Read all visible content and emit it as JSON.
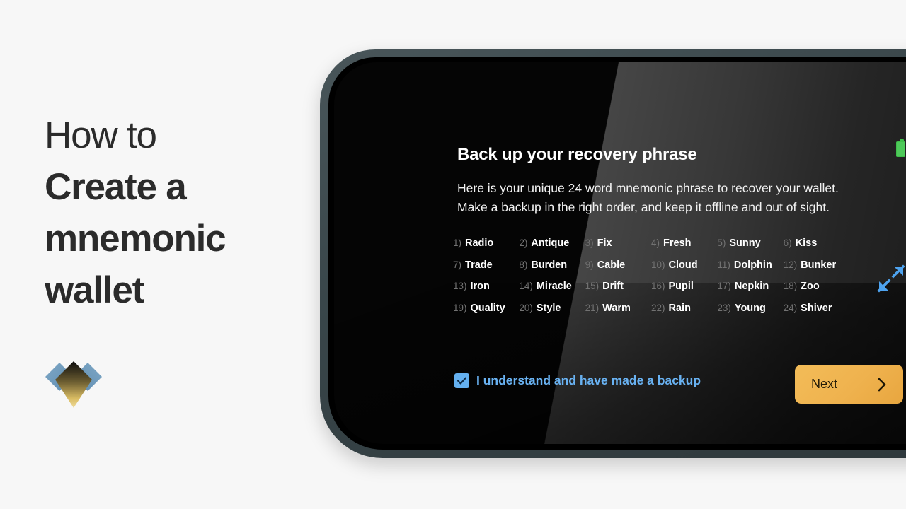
{
  "page": {
    "background_color": "#f7f7f7"
  },
  "left_panel": {
    "title_lines": [
      {
        "text": "How to",
        "weight": "light"
      },
      {
        "text": "Create a",
        "weight": "bold"
      },
      {
        "text": "mnemonic",
        "weight": "bold"
      },
      {
        "text": "wallet",
        "weight": "bold"
      }
    ],
    "logo": {
      "icon": "diamond-gem-logo",
      "wing_color": "#6e97bb",
      "center_gradient_from": "#111111",
      "center_gradient_to": "#e7c356"
    },
    "title_color": "#2b2b2b"
  },
  "device": {
    "bezel_color": "#3a4548",
    "screen_background": "#050505",
    "status": {
      "battery_icon": "battery-full-icon",
      "battery_color": "#4ec95a"
    },
    "expand_icon": "expand-arrows-icon",
    "expand_icon_color": "#5aa9ef"
  },
  "screen": {
    "title": "Back up your recovery phrase",
    "body_lines": [
      "Here is your unique 24 word mnemonic phrase to recover your wallet.",
      "Make a backup in the right order, and keep it offline and out of sight."
    ],
    "mnemonic": {
      "count": 24,
      "index_color": "#727272",
      "word_color": "#ffffff",
      "words": [
        {
          "index": "1)",
          "word": "Radio"
        },
        {
          "index": "2)",
          "word": "Antique"
        },
        {
          "index": "3)",
          "word": "Fix"
        },
        {
          "index": "4)",
          "word": "Fresh"
        },
        {
          "index": "5)",
          "word": "Sunny"
        },
        {
          "index": "6)",
          "word": "Kiss"
        },
        {
          "index": "7)",
          "word": "Trade"
        },
        {
          "index": "8)",
          "word": "Burden"
        },
        {
          "index": "9)",
          "word": "Cable"
        },
        {
          "index": "10)",
          "word": "Cloud"
        },
        {
          "index": "11)",
          "word": "Dolphin"
        },
        {
          "index": "12)",
          "word": "Bunker"
        },
        {
          "index": "13)",
          "word": "Iron"
        },
        {
          "index": "14)",
          "word": "Miracle"
        },
        {
          "index": "15)",
          "word": "Drift"
        },
        {
          "index": "16)",
          "word": "Pupil"
        },
        {
          "index": "17)",
          "word": "Nepkin"
        },
        {
          "index": "18)",
          "word": "Zoo"
        },
        {
          "index": "19)",
          "word": "Quality"
        },
        {
          "index": "20)",
          "word": "Style"
        },
        {
          "index": "21)",
          "word": "Warm"
        },
        {
          "index": "22)",
          "word": "Rain"
        },
        {
          "index": "23)",
          "word": "Young"
        },
        {
          "index": "24)",
          "word": "Shiver"
        }
      ]
    },
    "confirm": {
      "checked": true,
      "label": "I understand and have made a backup",
      "accent_color": "#69b2f2"
    },
    "next_button": {
      "label": "Next",
      "icon": "chevron-right-icon",
      "background_color": "#efb24e",
      "text_color": "#241c08"
    }
  }
}
